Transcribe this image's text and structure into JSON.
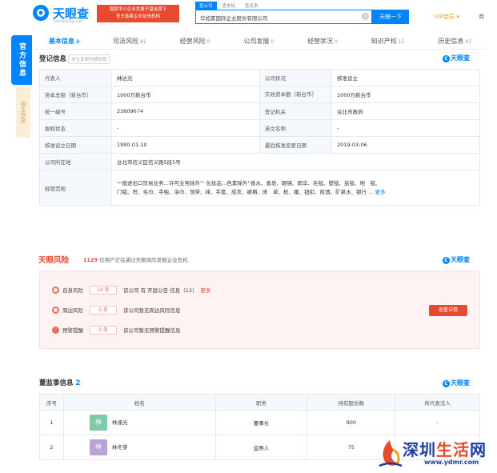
{
  "header": {
    "logo_title": "天眼查",
    "logo_sub": "TianYanCha.com",
    "promo_line1": "国家中小企业发展子基金旗下",
    "promo_line2": "官方备案企业征信机构",
    "search_tabs": [
      "查公司",
      "查老板",
      "查关系"
    ],
    "search_value": "华如素国际企业股份有限公司",
    "search_button": "天眼一下",
    "vip_label": "VIP会员 ▾",
    "more_label": "商"
  },
  "side_tabs": {
    "official": "官方信息",
    "self": "自主信息"
  },
  "nav": [
    {
      "label": "基本信息",
      "count": "3"
    },
    {
      "label": "司法风险",
      "count": "81"
    },
    {
      "label": "经营风险",
      "count": "0"
    },
    {
      "label": "公司发展",
      "count": "0"
    },
    {
      "label": "经营状况",
      "count": "0"
    },
    {
      "label": "知识产权",
      "count": "15"
    },
    {
      "label": "历史信息",
      "count": "47"
    }
  ],
  "brand": "天眼查",
  "registration": {
    "title": "登记信息",
    "hint": "发生变更时通知我",
    "rows": [
      {
        "l1": "代表人",
        "v1": "林达光",
        "l2": "公司状况",
        "v2": "核准设立"
      },
      {
        "l1": "资本总额（新台币）",
        "v1": "1000万新台币",
        "l2": "实收资本额（新台币）",
        "v2": "1000万新台币"
      },
      {
        "l1": "统一编号",
        "v1": "23609674",
        "l2": "登记机关",
        "v2": "台北市政府"
      },
      {
        "l1": "股权状态",
        "v1": "-",
        "l2": "英文名称",
        "v2": "-"
      },
      {
        "l1": "核准设立日期",
        "v1": "1990-01-10",
        "l2": "最后核准变更日期",
        "v2": "2019-03-06"
      }
    ],
    "address_label": "公司所在地",
    "address": "台北市信义区信义路5段5号",
    "scope_label": "经营范围",
    "scope_line1": "一般进出口贸易业务…许可业务除外''' 化妆品…色素除外''香水、香皂、眼镜、雨伞、毛毯、壁毯、盐毯、地　毯、",
    "scope_line2": "门毯、帘、毛巾、手帕、浴巾、领带、袜、手套、成衣、被褥、床　单、枕、履、钮扣、煎酒、矿泉水、银行 …",
    "scope_more": "更多"
  },
  "risk": {
    "logo": "天眼风险",
    "count": "1129",
    "desc": "位用户正在通过天眼风险发掘企业危机",
    "rows": [
      {
        "label": "自身风险",
        "badge": "54 条",
        "text": "该公司 有 开庭公告 信息（12）",
        "more": "更多"
      },
      {
        "label": "周边风险",
        "badge": "0 条",
        "text": "该公司暂无周边风险信息",
        "more": ""
      },
      {
        "label": "预警提醒",
        "badge": "0 条",
        "text": "该公司暂无预警提醒信息",
        "more": ""
      }
    ],
    "button": "查看详情"
  },
  "directors": {
    "title": "董监事信息",
    "count": "2",
    "headers": [
      "序号",
      "姓名",
      "职务",
      "持有股份数",
      "所代表法人"
    ],
    "rows": [
      {
        "no": "1",
        "avatar": "林",
        "avatar_color": "#7fc9a8",
        "name": "林達光",
        "role": "董事长",
        "shares": "900",
        "rep": "-"
      },
      {
        "no": "2",
        "avatar": "林",
        "avatar_color": "#b9a3d6",
        "name": "林冬芽",
        "role": "监察人",
        "shares": "75",
        "rep": ""
      }
    ]
  },
  "watermark": {
    "text_a": "深圳",
    "text_b": "生活",
    "text_c": "网",
    "url": "www.ydmr.com"
  }
}
